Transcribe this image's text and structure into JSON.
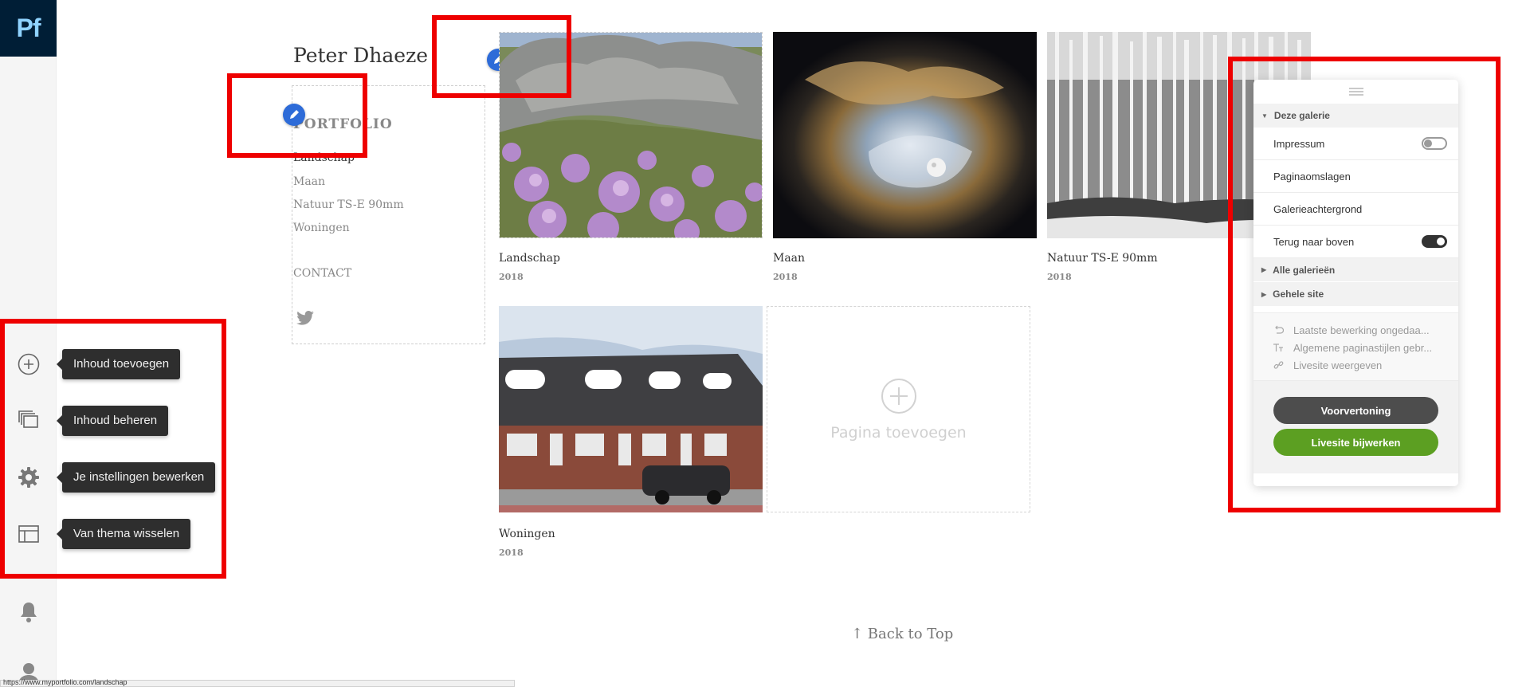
{
  "app": {
    "logo_text": "Pf",
    "brand_color": "#001e36"
  },
  "rail": {
    "items": [
      {
        "icon": "plus-circle-icon",
        "tooltip": "Inhoud toevoegen"
      },
      {
        "icon": "stacked-pages-icon",
        "tooltip": "Inhoud beheren"
      },
      {
        "icon": "gear-icon",
        "tooltip": "Je instellingen bewerken"
      },
      {
        "icon": "layout-icon",
        "tooltip": "Van thema wisselen"
      }
    ],
    "bottom_icons": [
      "bell-icon",
      "user-icon"
    ]
  },
  "site": {
    "title": "Peter Dhaeze",
    "nav": {
      "heading": "PORTFOLIO",
      "items": [
        "Landschap",
        "Maan",
        "Natuur TS-E 90mm",
        "Woningen"
      ],
      "active": "Landschap",
      "contact": "CONTACT",
      "social_icon": "twitter-icon"
    },
    "gallery": [
      {
        "title": "Landschap",
        "year": "2018"
      },
      {
        "title": "Maan",
        "year": "2018"
      },
      {
        "title": "Natuur TS-E 90mm",
        "year": "2018"
      },
      {
        "title": "Woningen",
        "year": "2018"
      }
    ],
    "add_page_label": "Pagina toevoegen",
    "back_to_top": "↑  Back to Top"
  },
  "panel": {
    "section_current": "Deze galerie",
    "rows": [
      {
        "label": "Impressum",
        "toggle": "off"
      },
      {
        "label": "Paginaomslagen"
      },
      {
        "label": "Galerieachtergrond"
      },
      {
        "label": "Terug naar boven",
        "toggle": "on"
      }
    ],
    "section_all": "Alle galerieën",
    "section_site": "Gehele site",
    "links": [
      {
        "icon": "undo-icon",
        "label": "Laatste bewerking ongedaa..."
      },
      {
        "icon": "text-style-icon",
        "label": "Algemene paginastijlen gebr..."
      },
      {
        "icon": "link-icon",
        "label": "Livesite weergeven"
      }
    ],
    "preview_button": "Voorvertoning",
    "publish_button": "Livesite bijwerken",
    "colors": {
      "preview": "#4d4d4d",
      "publish": "#5c9f22",
      "annotation_red": "#ee0000",
      "edit_blue": "#2d6bd8"
    }
  },
  "statusbar": {
    "url": "https://www.myportfolio.com/landschap"
  }
}
